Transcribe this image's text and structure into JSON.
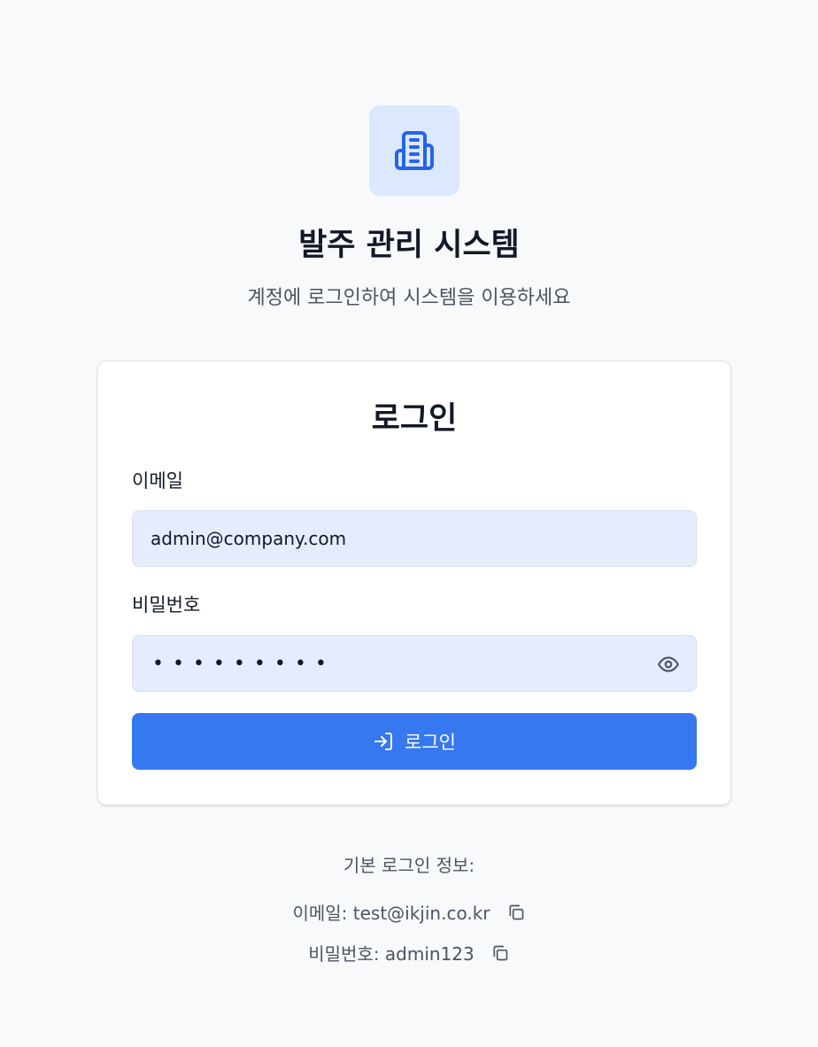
{
  "header": {
    "logo_icon": "building-icon",
    "title": "발주 관리 시스템",
    "subtitle": "계정에 로그인하여 시스템을 이용하세요"
  },
  "login_card": {
    "title": "로그인",
    "email": {
      "label": "이메일",
      "value": "admin@company.com"
    },
    "password": {
      "label": "비밀번호",
      "masked_value": "•••••••••",
      "toggle_icon": "eye-icon"
    },
    "submit": {
      "label": "로그인",
      "icon": "log-in-icon"
    }
  },
  "default_credentials": {
    "title": "기본 로그인 정보:",
    "email_line": "이메일: test@ikjin.co.kr",
    "password_line": "비밀번호: admin123",
    "copy_icon": "copy-icon"
  },
  "colors": {
    "accent": "#3578f0",
    "logo_bg": "#dbe8fd",
    "logo_fg": "#2563eb",
    "input_bg": "#e5edfd",
    "page_bg": "#f7f9fb"
  }
}
